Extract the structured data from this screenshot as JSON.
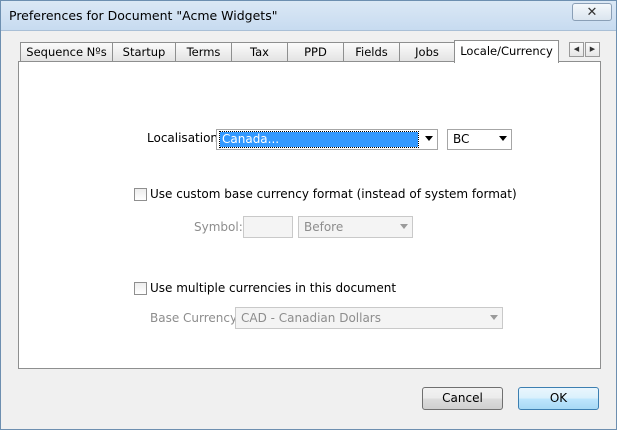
{
  "window": {
    "title": "Preferences for Document \"Acme Widgets\"",
    "close_symbol": "✕"
  },
  "tabs": [
    {
      "label": "Sequence Nºs"
    },
    {
      "label": "Startup"
    },
    {
      "label": "Terms"
    },
    {
      "label": "Tax"
    },
    {
      "label": "PPD"
    },
    {
      "label": "Fields"
    },
    {
      "label": "Jobs"
    },
    {
      "label": "Locale/Currency",
      "active": true
    }
  ],
  "tab_scroll": {
    "left_symbol": "◀",
    "right_symbol": "▶"
  },
  "localisation": {
    "label": "Localisation:",
    "value": "Canada...",
    "region": "BC"
  },
  "custom_format": {
    "checkbox_label": "Use custom base currency format (instead of system format)",
    "checked": false,
    "symbol_label": "Symbol:",
    "symbol_value": "",
    "position_value": "Before"
  },
  "multi_currency": {
    "checkbox_label": "Use multiple currencies in this document",
    "checked": false,
    "base_label": "Base Currency:",
    "base_value": "CAD - Canadian Dollars"
  },
  "buttons": {
    "cancel": "Cancel",
    "ok": "OK"
  }
}
